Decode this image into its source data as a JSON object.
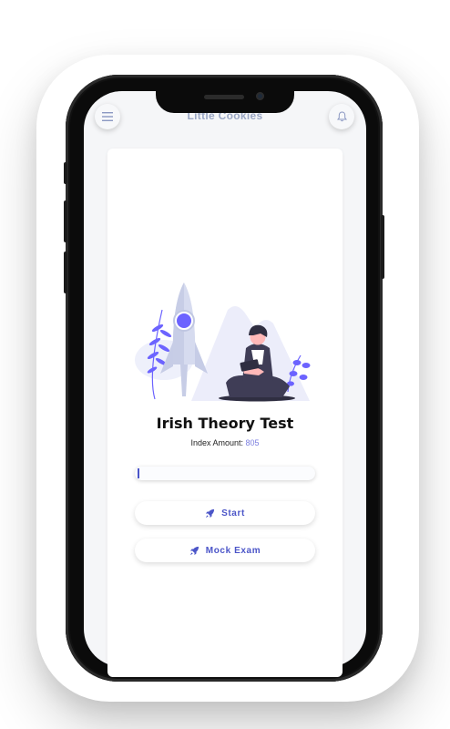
{
  "header": {
    "app_title": "Little Cookies",
    "menu_icon": "hamburger-menu-icon",
    "bell_icon": "bell-icon"
  },
  "main": {
    "illustration": "rocket-launch-illustration",
    "title": "Irish Theory Test",
    "index_label": "Index Amount:",
    "index_value": "805",
    "progress_fraction": 0.01,
    "buttons": [
      {
        "label": "Start",
        "icon": "rocket-icon"
      },
      {
        "label": "Mock Exam",
        "icon": "rocket-icon"
      }
    ]
  },
  "colors": {
    "accent": "#4b55c8",
    "muted_title": "#9aa6c3",
    "index_value": "#7b7fe0",
    "screen_bg": "#f5f6f8"
  }
}
